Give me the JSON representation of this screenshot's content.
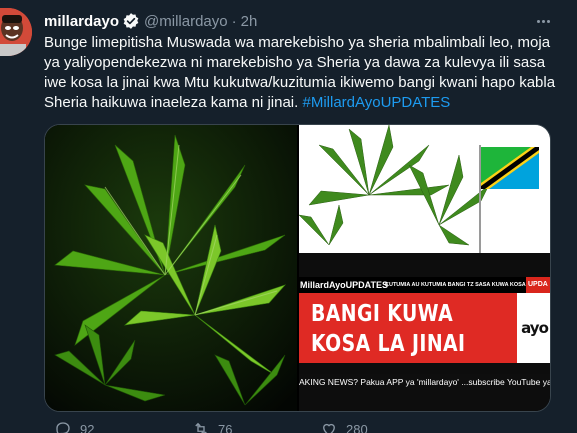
{
  "tweet": {
    "display_name": "millardayo",
    "handle": "@millardayo",
    "separator": "·",
    "time": "2h",
    "body": "Bunge limepitisha Muswada wa marekebisho ya sheria mbalimbali leo, moja ya yaliyopendekezwa ni marekebisho ya Sheria ya dawa za kulevya ili sasa iwe kosa la jinai kwa Mtu kukutwa/kuzitumia ikiwemo bangi kwani hapo kabla Sheria haikuwa inaeleza kama ni jinai.",
    "hashtag": "#MillardAyoUPDATES"
  },
  "media": {
    "news_brand": "MillardAyoUPDATES",
    "news_subheadline": "KUTUMIA AU KUTUMIA BANGI TZ SASA KUWA KOSA LA JINAI",
    "news_tag": "UPDA",
    "headline_line1": "BANGI KUWA",
    "headline_line2": "KOSA LA JINAI",
    "logo_text": "ayo",
    "ticker": "AKING NEWS? Pakua APP ya 'millardayo' ...subscribe YouTube ya 'millardayo'"
  },
  "actions": {
    "reply_count": "92",
    "retweet_count": "76",
    "like_count": "280"
  },
  "colors": {
    "background": "#15202b",
    "accent": "#1d9bf0",
    "muted": "#8b98a5",
    "news_red": "#df2a24"
  },
  "icons": [
    "verified-badge-icon",
    "more-options-icon",
    "reply-icon",
    "retweet-icon",
    "like-icon"
  ]
}
